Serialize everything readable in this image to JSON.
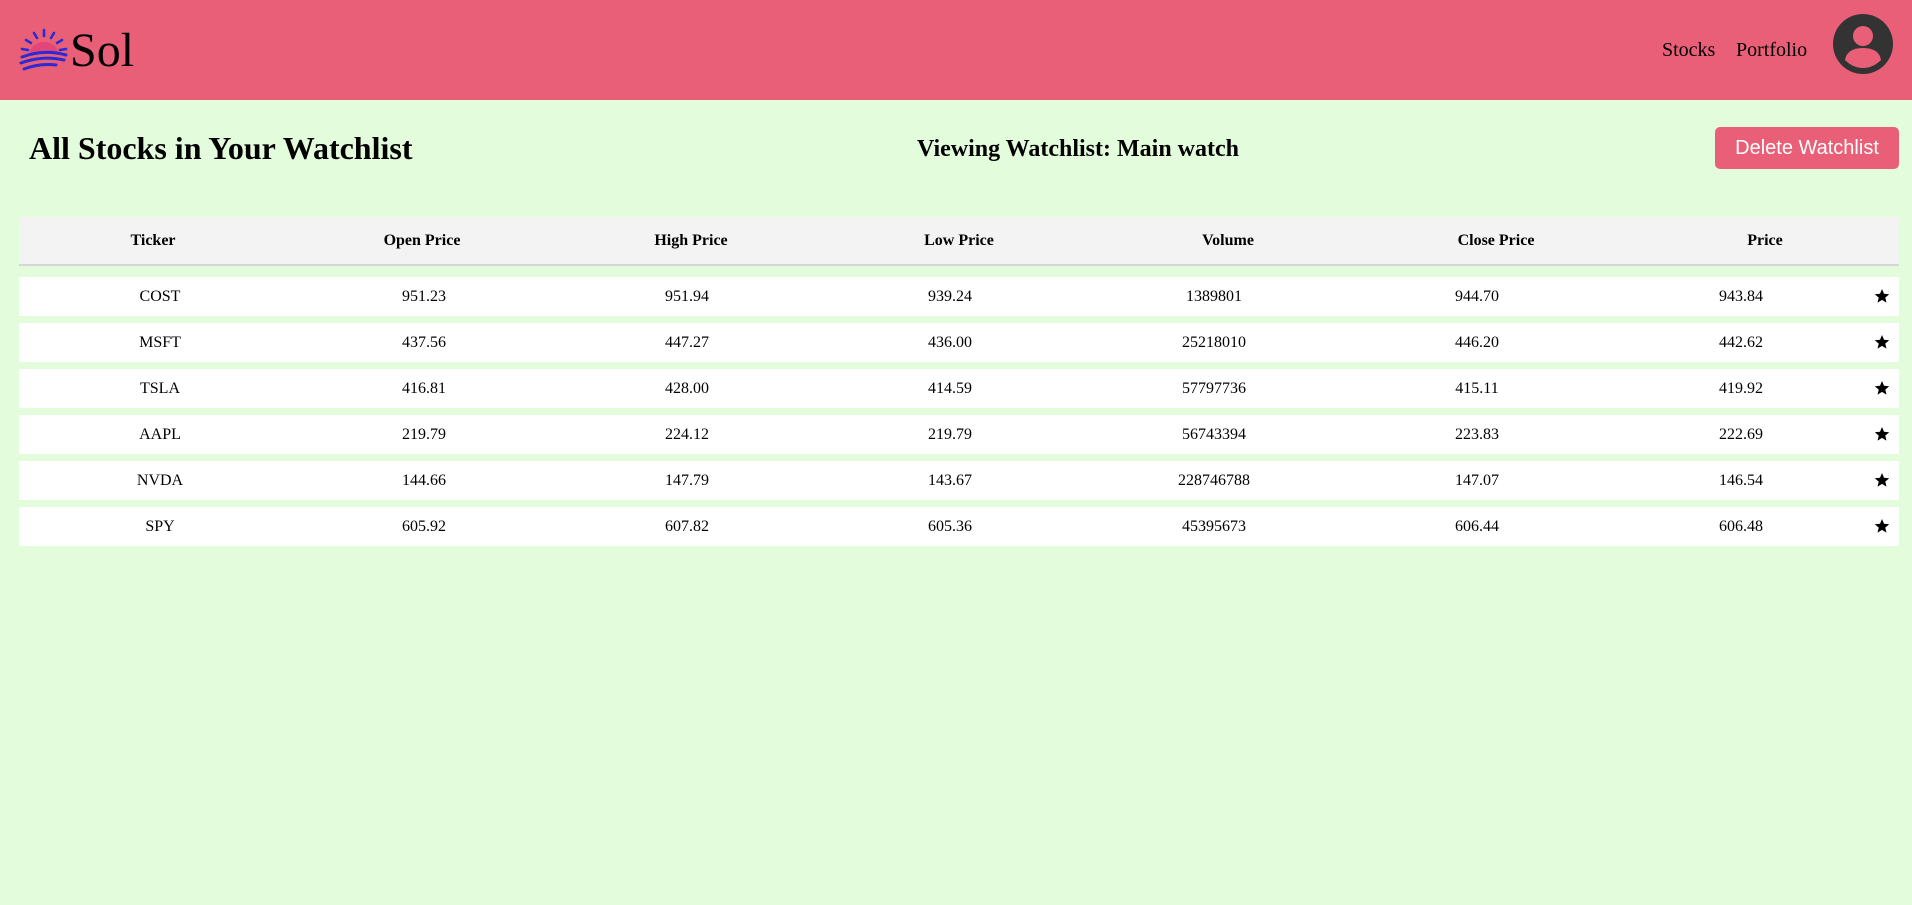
{
  "app": {
    "name": "Sol"
  },
  "nav": {
    "stocks_label": "Stocks",
    "portfolio_label": "Portfolio"
  },
  "page": {
    "title": "All Stocks in Your Watchlist",
    "watchlist_label": "Viewing Watchlist: Main watch",
    "delete_label": "Delete Watchlist"
  },
  "table": {
    "headers": [
      "Ticker",
      "Open Price",
      "High Price",
      "Low Price",
      "Volume",
      "Close Price",
      "Price"
    ],
    "rows": [
      [
        "COST",
        "951.23",
        "951.94",
        "939.24",
        "1389801",
        "944.70",
        "943.84"
      ],
      [
        "MSFT",
        "437.56",
        "447.27",
        "436.00",
        "25218010",
        "446.20",
        "442.62"
      ],
      [
        "TSLA",
        "416.81",
        "428.00",
        "414.59",
        "57797736",
        "415.11",
        "419.92"
      ],
      [
        "AAPL",
        "219.79",
        "224.12",
        "219.79",
        "56743394",
        "223.83",
        "222.69"
      ],
      [
        "NVDA",
        "144.66",
        "147.79",
        "143.67",
        "228746788",
        "147.07",
        "146.54"
      ],
      [
        "SPY",
        "605.92",
        "607.82",
        "605.36",
        "45395673",
        "606.44",
        "606.48"
      ]
    ],
    "row_action_icon": "star-icon"
  },
  "colors": {
    "header_bg": "#e95f77",
    "page_bg": "#e3fcdc",
    "button_bg": "#e95f77",
    "logo_blue": "#2b2bd6"
  }
}
